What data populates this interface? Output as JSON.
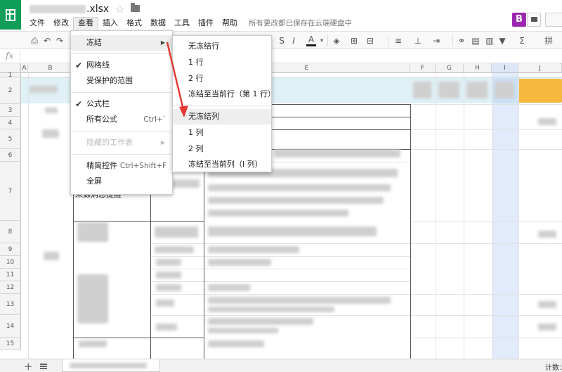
{
  "doc": {
    "title_suffix": ".xlsx"
  },
  "menubar": {
    "items": [
      "文件",
      "修改",
      "查看",
      "插入",
      "格式",
      "数据",
      "工具",
      "插件",
      "帮助"
    ],
    "save_status": "所有更改都已保存在云端硬盘中"
  },
  "user": {
    "avatar_letter": "B"
  },
  "columns": [
    "A",
    "B",
    "C",
    "D",
    "E",
    "F",
    "G",
    "H",
    "I",
    "J"
  ],
  "rows": [
    "1",
    "2",
    "3",
    "4",
    "5",
    "6",
    "7",
    "8",
    "9",
    "10",
    "11",
    "12",
    "13",
    "14",
    "15"
  ],
  "cells": {
    "c7_text": "来源消息提醒"
  },
  "view_menu": {
    "freeze": "冻结",
    "gridlines": "网格线",
    "protected_ranges": "受保护的范围",
    "formula_bar": "公式栏",
    "all_formulas": "所有公式",
    "all_formulas_shortcut": "Ctrl+`",
    "hidden_sheets": "隐藏的工作表",
    "compact_controls": "精简控件",
    "compact_controls_shortcut": "Ctrl+Shift+F",
    "full_screen": "全屏"
  },
  "freeze_menu": {
    "no_rows": "无冻结行",
    "one_row": "1 行",
    "two_rows": "2 行",
    "up_to_row": "冻结至当前行（第 1 行）",
    "no_columns": "无冻结列",
    "one_column": "1 列",
    "two_columns": "2 列",
    "up_to_column": "冻结至当前列（I 列）"
  },
  "status": {
    "count_label": "计数："
  },
  "colors": {
    "brand": "#0f9d58",
    "avatar": "#9b27af",
    "arrow": "#e53935",
    "header_band": "#dff0f7",
    "orange": "#f6b83d"
  }
}
